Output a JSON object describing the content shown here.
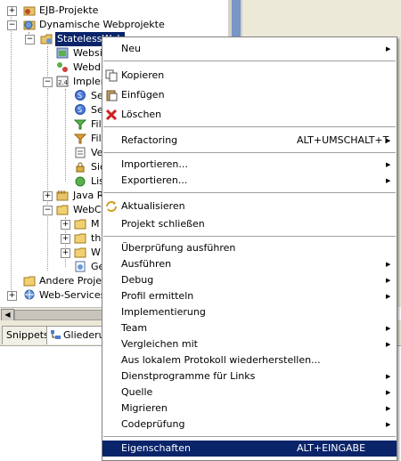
{
  "tree": {
    "ejb": "EJB-Projekte",
    "dyn": "Dynamische Webprojekte",
    "stateless": "StatelessWeb",
    "websi": "Websi",
    "webd": "Webd",
    "impl": "Implem",
    "se1": "Se",
    "se2": "Se",
    "fi1": "Fil",
    "fi2": "Fil",
    "ve": "Ve",
    "si": "Sic",
    "li": "Lis",
    "java": "Java R",
    "webc": "WebC",
    "m": "M",
    "th": "th",
    "w": "W",
    "ge": "Ge",
    "andere": "Andere Projekt",
    "webservices": "Web-Services"
  },
  "tabs": {
    "snippets": "Snippets",
    "gliederung": "Gliederu"
  },
  "menu": {
    "neu": "Neu",
    "kopieren": "Kopieren",
    "einfuegen": "Einfügen",
    "loeschen": "Löschen",
    "refactoring": "Refactoring",
    "refactoring_sc": "ALT+UMSCHALT+T",
    "importieren": "Importieren...",
    "exportieren": "Exportieren...",
    "aktualisieren": "Aktualisieren",
    "schliessen": "Projekt schließen",
    "pruefung": "Überprüfung ausführen",
    "ausfuehren": "Ausführen",
    "debug": "Debug",
    "profil": "Profil ermitteln",
    "implementierung": "Implementierung",
    "team": "Team",
    "vergleichen": "Vergleichen mit",
    "protokoll": "Aus lokalem Protokoll wiederherstellen...",
    "dienstprogramme": "Dienstprogramme für Links",
    "quelle": "Quelle",
    "migrieren": "Migrieren",
    "codepruefung": "Codeprüfung",
    "eigenschaften": "Eigenschaften",
    "eigenschaften_sc": "ALT+EINGABE"
  },
  "colors": {
    "selection": "#0a246a",
    "menu_bg": "#ffffff",
    "view_bg": "#ece9d8"
  }
}
